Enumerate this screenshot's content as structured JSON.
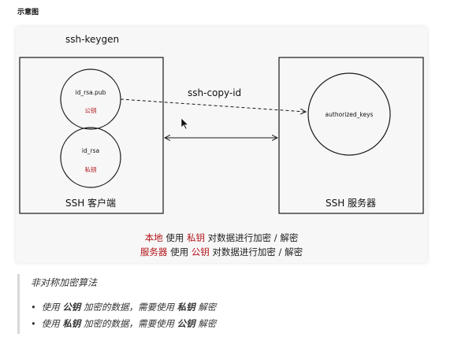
{
  "page": {
    "heading": "示意图"
  },
  "diagram": {
    "command_keygen": "ssh-keygen",
    "command_copy_id": "ssh-copy-id",
    "client": {
      "label": "SSH 客户端",
      "public_key": {
        "filename": "id_rsa.pub",
        "kind": "公钥"
      },
      "private_key": {
        "filename": "id_rsa",
        "kind": "私钥"
      }
    },
    "server": {
      "label": "SSH 服务器",
      "authorized": {
        "filename": "authorized_keys"
      }
    },
    "legend": [
      {
        "actor": "本地",
        "pre": "使用",
        "key": "私钥",
        "post": "对数据进行加密 / 解密"
      },
      {
        "actor": "服务器",
        "pre": "使用",
        "key": "公钥",
        "post": "对数据进行加密 / 解密"
      }
    ],
    "colors": {
      "highlight": "#b3141b",
      "stroke": "#1a1a1a"
    }
  },
  "notes": {
    "title": "非对称加密算法",
    "items": [
      {
        "pre": "使用",
        "key": "公钥",
        "mid": "加密的数据，需要使用",
        "key2": "私钥",
        "post": "解密"
      },
      {
        "pre": "使用",
        "key": "私钥",
        "mid": "加密的数据，需要使用",
        "key2": "公钥",
        "post": "解密"
      }
    ]
  }
}
